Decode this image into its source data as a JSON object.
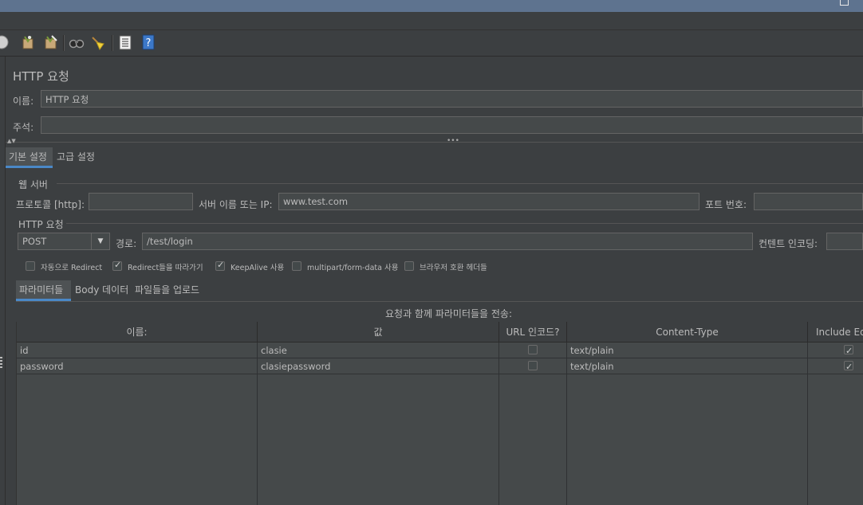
{
  "panel": {
    "title": "HTTP 요청",
    "name_label": "이름:",
    "name_value": "HTTP 요청",
    "comment_label": "주석:",
    "comment_value": ""
  },
  "config_tabs": [
    "기본 설정",
    "고급 설정"
  ],
  "web_server": {
    "section_label": "웹 서버",
    "protocol_label": "프로토콜 [http]:",
    "protocol_value": "",
    "server_label": "서버 이름 또는 IP:",
    "server_value": "www.test.com",
    "port_label": "포트 번호:",
    "port_value": ""
  },
  "http_request": {
    "section_label": "HTTP 요청",
    "method": "POST",
    "path_label": "경로:",
    "path_value": "/test/login",
    "encoding_label": "컨텐트 인코딩:",
    "encoding_value": ""
  },
  "options": [
    {
      "label": "자동으로 Redirect",
      "checked": false
    },
    {
      "label": "Redirect들을 따라가기",
      "checked": true
    },
    {
      "label": "KeepAlive 사용",
      "checked": true
    },
    {
      "label": "multipart/form-data 사용",
      "checked": false
    },
    {
      "label": "브라우저 호환 헤더들",
      "checked": false
    }
  ],
  "param_tabs": [
    "파라미터들",
    "Body 데이터",
    "파일들을 업로드"
  ],
  "params_caption": "요청과 함께 파라미터들을 전송:",
  "table": {
    "headers": [
      "이름:",
      "값",
      "URL 인코드?",
      "Content-Type",
      "Include Equ"
    ],
    "rows": [
      {
        "name": "id",
        "value": "clasie",
        "url_encode": false,
        "content_type": "text/plain",
        "include_equals": true
      },
      {
        "name": "password",
        "value": "clasiepassword",
        "url_encode": false,
        "content_type": "text/plain",
        "include_equals": true
      }
    ]
  },
  "toolbar_icons": [
    "stop-icon",
    "clear-icon",
    "clear-all-icon",
    "search-icon",
    "reset-search-icon",
    "function-helper-icon",
    "help-icon"
  ],
  "colors": {
    "background": "#3c3f41",
    "field": "#45494a",
    "accent": "#4a88c7",
    "titlebar": "#5e738f"
  }
}
